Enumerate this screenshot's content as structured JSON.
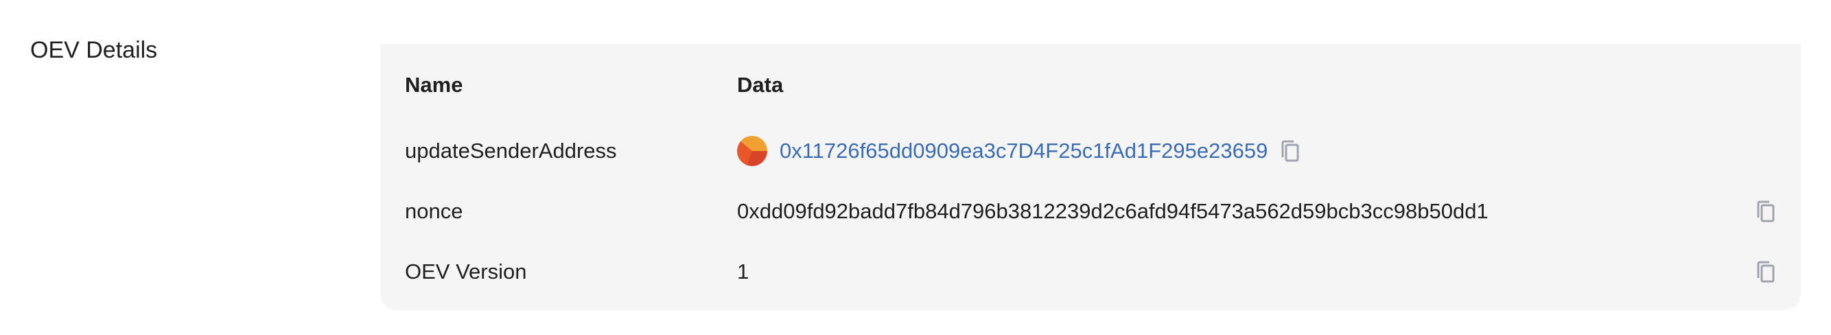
{
  "section": {
    "title": "OEV Details"
  },
  "table": {
    "headers": {
      "name": "Name",
      "data": "Data"
    },
    "rows": [
      {
        "name": "updateSenderAddress",
        "value": "0x11726f65dd0909ea3c7D4F25c1fAd1F295e23659",
        "value_type": "address-link",
        "icon": "copy-icon"
      },
      {
        "name": "nonce",
        "value": "0xdd09fd92badd7fb84d796b3812239d2c6afd94f5473a562d59bcb3cc98b50dd1",
        "value_type": "text",
        "icon": "copy-icon"
      },
      {
        "name": "OEV Version",
        "value": "1",
        "value_type": "text",
        "icon": "copy-icon"
      }
    ]
  },
  "colors": {
    "panel_background": "#f5f5f5",
    "link": "#3a6cb4",
    "text": "#1f1f1f",
    "icon": "#a0a4ad"
  }
}
